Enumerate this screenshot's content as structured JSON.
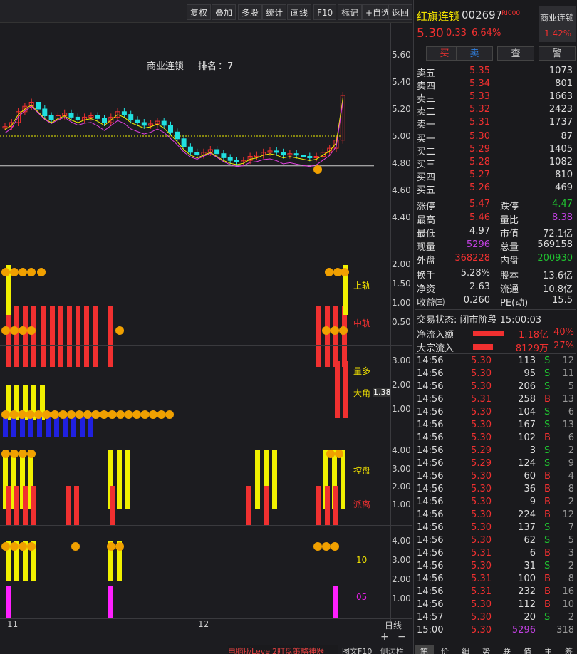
{
  "toolbar": {
    "buttons": [
      "复权",
      "叠加",
      "多股",
      "统计",
      "画线",
      "F10",
      "标记",
      "+自选",
      "返回"
    ]
  },
  "chart": {
    "title": "商业连锁",
    "rank_label": "排名",
    "rank_value": "：7",
    "price_ticks": [
      "5.60",
      "5.40",
      "5.20",
      "5.00",
      "4.80",
      "4.60",
      "4.40"
    ],
    "panel2_ticks": [
      "2.00",
      "1.50",
      "1.00",
      "0.50"
    ],
    "panel2_labels": [
      "上轨",
      "中轨"
    ],
    "panel3_ticks": [
      "3.00",
      "2.00",
      "1.00"
    ],
    "panel3_labels": [
      "量多",
      "大角"
    ],
    "panel3_value": "1.38",
    "panel4_ticks": [
      "4.00",
      "3.00",
      "2.00",
      "1.00"
    ],
    "panel4_labels": [
      "控盘",
      "派离"
    ],
    "panel5_ticks": [
      "4.00",
      "3.00",
      "2.00",
      "1.00"
    ],
    "panel5_labels": [
      "10",
      "05"
    ],
    "x_labels": [
      "11",
      "12"
    ],
    "period": "日线",
    "zoom_in": "+",
    "zoom_out": "−",
    "colors": {
      "up": "#f03030",
      "down": "#20e0e0",
      "yellow": "#f0f000",
      "magenta": "#ff20ff",
      "blue": "#2020e0"
    }
  },
  "quote": {
    "name": "红旗连锁",
    "code": "002697",
    "badge": "RI000",
    "price": "5.30",
    "change": "0.33",
    "pct": "6.64%",
    "sector": "商业连锁",
    "sector_pct": "1.42%",
    "actions": [
      "买",
      "卖",
      "查",
      "警"
    ],
    "asks": [
      {
        "l": "卖五",
        "p": "5.35",
        "v": "1073"
      },
      {
        "l": "卖四",
        "p": "5.34",
        "v": "801"
      },
      {
        "l": "卖三",
        "p": "5.33",
        "v": "1663"
      },
      {
        "l": "卖二",
        "p": "5.32",
        "v": "2423"
      },
      {
        "l": "卖一",
        "p": "5.31",
        "v": "1737"
      }
    ],
    "bids": [
      {
        "l": "买一",
        "p": "5.30",
        "v": "87"
      },
      {
        "l": "买二",
        "p": "5.29",
        "v": "1405"
      },
      {
        "l": "买三",
        "p": "5.28",
        "v": "1082"
      },
      {
        "l": "买四",
        "p": "5.27",
        "v": "810"
      },
      {
        "l": "买五",
        "p": "5.26",
        "v": "469"
      }
    ],
    "stats": [
      [
        "涨停",
        "5.47",
        "跌停",
        "4.47"
      ],
      [
        "最高",
        "5.46",
        "量比",
        "8.38"
      ],
      [
        "最低",
        "4.97",
        "市值",
        "72.1亿"
      ],
      [
        "现量",
        "5296",
        "总量",
        "569158"
      ],
      [
        "外盘",
        "368228",
        "内盘",
        "200930"
      ]
    ],
    "stats2": [
      [
        "换手",
        "5.28%",
        "股本",
        "13.6亿"
      ],
      [
        "净资",
        "2.63",
        "流通",
        "10.8亿"
      ],
      [
        "收益㈢",
        "0.260",
        "PE(动)",
        "15.5"
      ]
    ],
    "status": "交易状态: 闭市阶段 15:00:03",
    "flows": [
      {
        "l": "净流入额",
        "v": "1.18亿",
        "p": "40%",
        "w": 0.85
      },
      {
        "l": "大宗流入",
        "v": "8129万",
        "p": "27%",
        "w": 0.55
      }
    ],
    "ticks": [
      [
        "14:56",
        "5.30",
        "113",
        "S",
        "12"
      ],
      [
        "14:56",
        "5.30",
        "95",
        "S",
        "11"
      ],
      [
        "14:56",
        "5.30",
        "206",
        "S",
        "5"
      ],
      [
        "14:56",
        "5.31",
        "258",
        "B",
        "13"
      ],
      [
        "14:56",
        "5.30",
        "104",
        "S",
        "6"
      ],
      [
        "14:56",
        "5.30",
        "167",
        "S",
        "13"
      ],
      [
        "14:56",
        "5.30",
        "102",
        "B",
        "6"
      ],
      [
        "14:56",
        "5.29",
        "3",
        "S",
        "2"
      ],
      [
        "14:56",
        "5.29",
        "124",
        "S",
        "9"
      ],
      [
        "14:56",
        "5.30",
        "60",
        "B",
        "4"
      ],
      [
        "14:56",
        "5.30",
        "36",
        "B",
        "8"
      ],
      [
        "14:56",
        "5.30",
        "9",
        "B",
        "2"
      ],
      [
        "14:56",
        "5.30",
        "224",
        "B",
        "12"
      ],
      [
        "14:56",
        "5.30",
        "137",
        "S",
        "7"
      ],
      [
        "14:56",
        "5.30",
        "62",
        "S",
        "5"
      ],
      [
        "14:56",
        "5.31",
        "6",
        "B",
        "3"
      ],
      [
        "14:56",
        "5.30",
        "31",
        "S",
        "2"
      ],
      [
        "14:56",
        "5.31",
        "100",
        "B",
        "8"
      ],
      [
        "14:56",
        "5.31",
        "232",
        "B",
        "16"
      ],
      [
        "14:56",
        "5.30",
        "112",
        "B",
        "10"
      ],
      [
        "14:57",
        "5.30",
        "20",
        "S",
        "2"
      ],
      [
        "15:00",
        "5.30",
        "5296",
        "",
        "318"
      ]
    ],
    "bottom_tabs": [
      "笔",
      "价",
      "细",
      "势",
      "联",
      "值",
      "主",
      "筹"
    ]
  },
  "ad": {
    "text": "电脑版Level2盯盘策略神器",
    "f10": "图文F10",
    "side": "侧边栏"
  }
}
